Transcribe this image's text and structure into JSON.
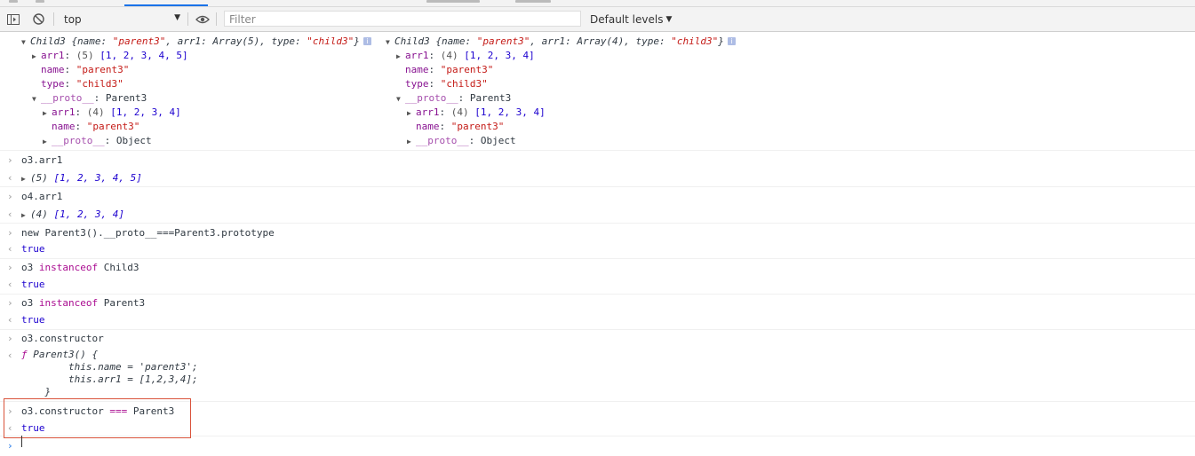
{
  "toolbar": {
    "context": "top",
    "filter_placeholder": "Filter",
    "levels": "Default levels"
  },
  "obj_left": {
    "header_name": "Child3",
    "header_rest": " {name: ",
    "header_name_val": "\"parent3\"",
    "header_arr": ", arr1: Array(5), type: ",
    "header_type_val": "\"child3\"",
    "header_close": "}",
    "arr1_label": "arr1",
    "arr1_count": "(5)",
    "arr1_values": "[1, 2, 3, 4, 5]",
    "name_label": "name",
    "name_value": "\"parent3\"",
    "type_label": "type",
    "type_value": "\"child3\"",
    "proto_label": "__proto__",
    "proto_value": "Parent3",
    "proto_arr1_label": "arr1",
    "proto_arr1_count": "(4)",
    "proto_arr1_values": "[1, 2, 3, 4]",
    "proto_name_label": "name",
    "proto_name_value": "\"parent3\"",
    "proto_proto_label": "__proto__",
    "proto_proto_value": "Object"
  },
  "obj_right": {
    "header_name": "Child3",
    "header_rest": " {name: ",
    "header_name_val": "\"parent3\"",
    "header_arr": ", arr1: Array(4), type: ",
    "header_type_val": "\"child3\"",
    "header_close": "}",
    "arr1_label": "arr1",
    "arr1_count": "(4)",
    "arr1_values": "[1, 2, 3, 4]",
    "name_label": "name",
    "name_value": "\"parent3\"",
    "type_label": "type",
    "type_value": "\"child3\"",
    "proto_label": "__proto__",
    "proto_value": "Parent3",
    "proto_arr1_label": "arr1",
    "proto_arr1_count": "(4)",
    "proto_arr1_values": "[1, 2, 3, 4]",
    "proto_name_label": "name",
    "proto_name_value": "\"parent3\"",
    "proto_proto_label": "__proto__",
    "proto_proto_value": "Object"
  },
  "entries": {
    "e1_in": "o3.arr1",
    "e1_count": "(5)",
    "e1_out": "[1, 2, 3, 4, 5]",
    "e2_in": "o4.arr1",
    "e2_count": "(4)",
    "e2_out": "[1, 2, 3, 4]",
    "e3_in": "new Parent3().__proto__===Parent3.prototype",
    "e3_out": "true",
    "e4_a": "o3 ",
    "e4_kw": "instanceof",
    "e4_b": " Child3",
    "e4_out": "true",
    "e5_a": "o3 ",
    "e5_kw": "instanceof",
    "e5_b": " Parent3",
    "e5_out": "true",
    "e6_in": "o3.constructor",
    "e6_f": "ƒ",
    "e6_l1": " Parent3() {",
    "e6_l2": "        this.name = 'parent3';",
    "e6_l3": "        this.arr1 = [1,2,3,4];",
    "e6_l4": "    }",
    "e7_a": "o3.constructor ",
    "e7_op": "===",
    "e7_b": " Parent3",
    "e7_out": "true"
  },
  "gutter": {
    "input": "›",
    "output": "‹"
  }
}
